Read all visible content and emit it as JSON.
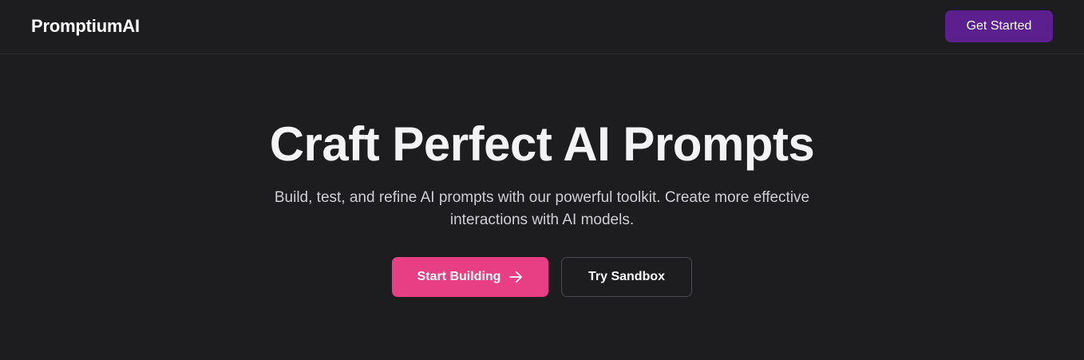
{
  "header": {
    "brand": "PromptiumAI",
    "cta_label": "Get Started"
  },
  "hero": {
    "title": "Craft Perfect AI Prompts",
    "subtitle": "Build, test, and refine AI prompts with our powerful toolkit. Create more effective interactions with AI models.",
    "primary_button": {
      "label": "Start Building",
      "icon": "arrow-right-icon"
    },
    "secondary_button": {
      "label": "Try Sandbox"
    }
  },
  "colors": {
    "background": "#1d1d1f",
    "header_cta": "#5b1f8e",
    "primary_button": "#e83e84",
    "secondary_border": "#4a4a50"
  }
}
